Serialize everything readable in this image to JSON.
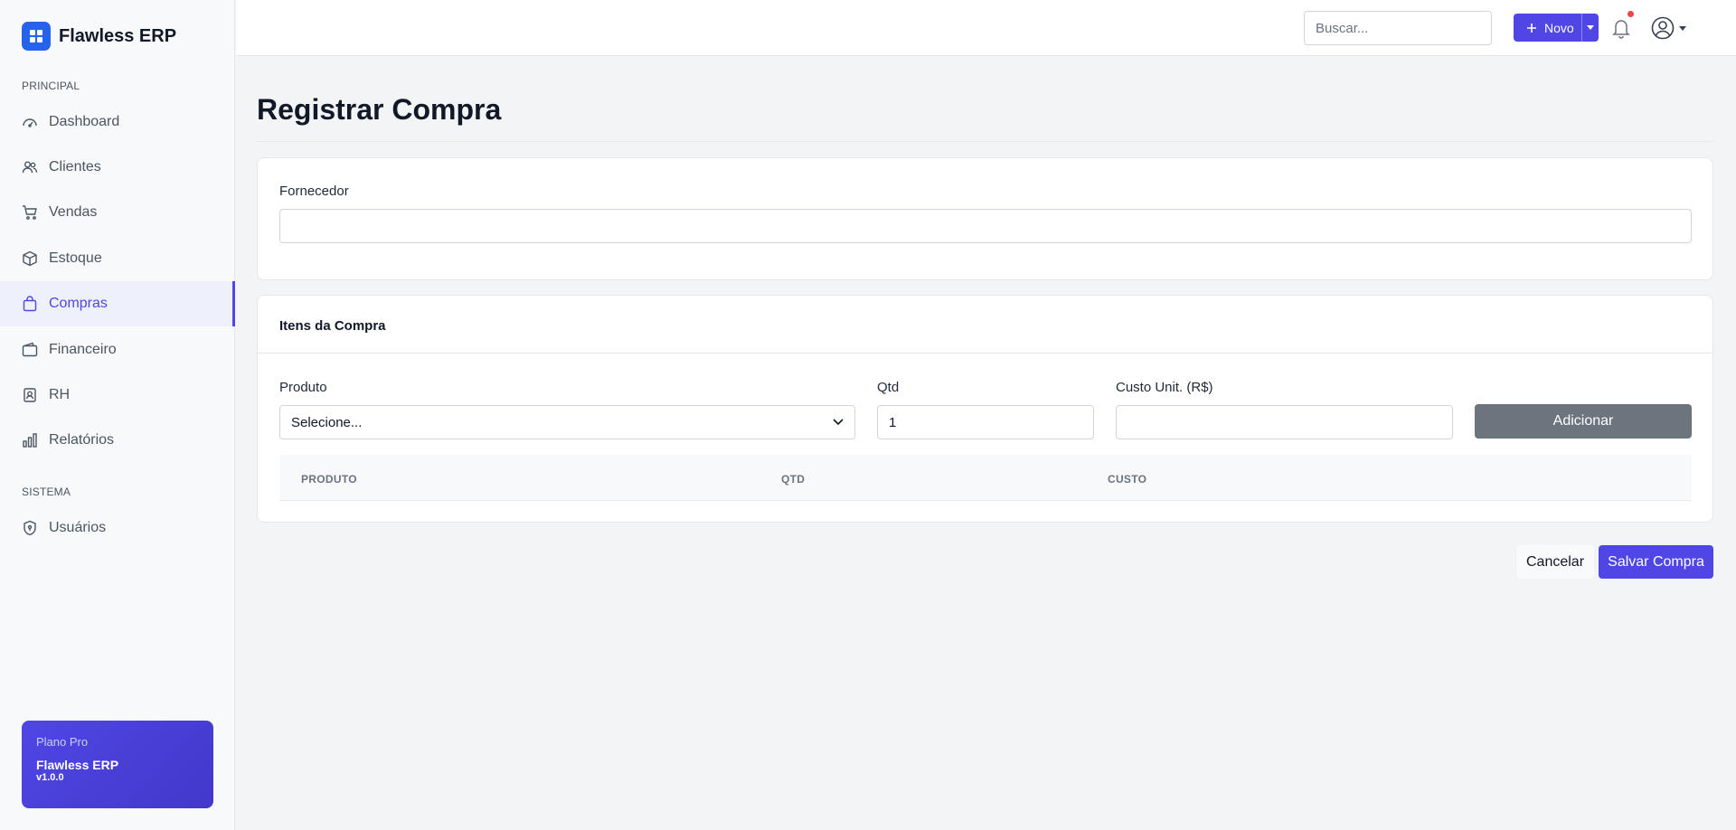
{
  "brand": {
    "name": "Flawless ERP"
  },
  "sidebar": {
    "principal_label": "PRINCIPAL",
    "items": [
      {
        "label": "Dashboard",
        "icon": "gauge-icon"
      },
      {
        "label": "Clientes",
        "icon": "users-icon"
      },
      {
        "label": "Vendas",
        "icon": "cart-icon"
      },
      {
        "label": "Estoque",
        "icon": "box-icon"
      },
      {
        "label": "Compras",
        "icon": "bag-icon",
        "active": true
      },
      {
        "label": "Financeiro",
        "icon": "wallet-icon"
      },
      {
        "label": "RH",
        "icon": "badge-icon"
      },
      {
        "label": "Relatórios",
        "icon": "bar-chart-icon"
      }
    ],
    "sistema_label": "SISTEMA",
    "system_items": [
      {
        "label": "Usuários",
        "icon": "shield-icon"
      }
    ],
    "plan": {
      "label": "Plano Pro",
      "name": "Flawless ERP",
      "version": "v1.0.0"
    }
  },
  "topbar": {
    "search_placeholder": "Buscar...",
    "new_label": "Novo"
  },
  "page": {
    "title": "Registrar Compra",
    "supplier_label": "Fornecedor",
    "supplier_value": "",
    "items_title": "Itens da Compra",
    "product_label": "Produto",
    "product_value": "Selecione...",
    "qty_label": "Qtd",
    "qty_value": "1",
    "cost_label": "Custo Unit. (R$)",
    "cost_value": "",
    "add_label": "Adicionar",
    "columns": [
      "PRODUTO",
      "QTD",
      "CUSTO"
    ],
    "cancel_label": "Cancelar",
    "save_label": "Salvar Compra"
  },
  "colors": {
    "accent": "#4f46e5",
    "brand_logo": "#2563eb",
    "secondary_button": "#6c757d",
    "notification": "#ef4444"
  }
}
